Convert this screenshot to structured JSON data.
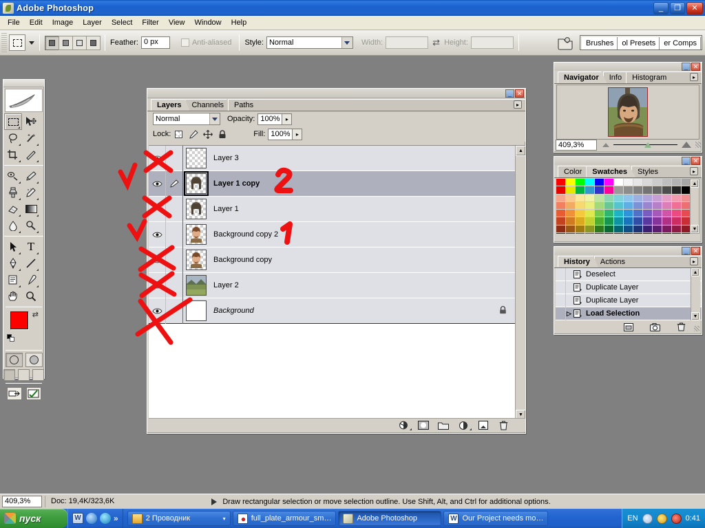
{
  "window": {
    "title": "Adobe Photoshop",
    "minimize_label": "_",
    "maximize_label": "❐",
    "close_label": "✕"
  },
  "menubar": {
    "items": [
      {
        "label": "File"
      },
      {
        "label": "Edit"
      },
      {
        "label": "Image"
      },
      {
        "label": "Layer"
      },
      {
        "label": "Select"
      },
      {
        "label": "Filter"
      },
      {
        "label": "View"
      },
      {
        "label": "Window"
      },
      {
        "label": "Help"
      }
    ]
  },
  "options_bar": {
    "tool_icon": "rectangular-marquee-icon",
    "feather_label": "Feather:",
    "feather_value": "0 px",
    "antialias_label": "Anti-aliased",
    "style_label": "Style:",
    "style_value": "Normal",
    "width_label": "Width:",
    "width_value": "",
    "height_label": "Height:",
    "height_value": "",
    "palette_tabs": [
      {
        "label": "Brushes"
      },
      {
        "label": "ol Presets"
      },
      {
        "label": "er Comps"
      }
    ]
  },
  "toolbox": {
    "tools": [
      {
        "name": "rectangular-marquee-tool",
        "selected": true
      },
      {
        "name": "move-tool",
        "selected": false
      },
      {
        "name": "lasso-tool",
        "selected": false
      },
      {
        "name": "magic-wand-tool",
        "selected": false
      },
      {
        "name": "crop-tool",
        "selected": false
      },
      {
        "name": "slice-tool",
        "selected": false
      },
      {
        "name": "healing-brush-tool",
        "selected": false
      },
      {
        "name": "brush-tool",
        "selected": false
      },
      {
        "name": "clone-stamp-tool",
        "selected": false
      },
      {
        "name": "history-brush-tool",
        "selected": false
      },
      {
        "name": "eraser-tool",
        "selected": false
      },
      {
        "name": "gradient-tool",
        "selected": false
      },
      {
        "name": "blur-tool",
        "selected": false
      },
      {
        "name": "dodge-tool",
        "selected": false
      },
      {
        "name": "path-selection-tool",
        "selected": false
      },
      {
        "name": "type-tool",
        "selected": false
      },
      {
        "name": "pen-tool",
        "selected": false
      },
      {
        "name": "line-tool",
        "selected": false
      },
      {
        "name": "notes-tool",
        "selected": false
      },
      {
        "name": "eyedropper-tool",
        "selected": false
      },
      {
        "name": "hand-tool",
        "selected": false
      },
      {
        "name": "zoom-tool",
        "selected": false
      }
    ],
    "foreground_color": "#ff0000",
    "background_color": "#ffffff"
  },
  "layers_panel": {
    "tabs": [
      {
        "label": "Layers",
        "active": true
      },
      {
        "label": "Channels",
        "active": false
      },
      {
        "label": "Paths",
        "active": false
      }
    ],
    "blend_mode": "Normal",
    "opacity_label": "Opacity:",
    "opacity_value": "100%",
    "lock_label": "Lock:",
    "fill_label": "Fill:",
    "fill_value": "100%",
    "lock_buttons": [
      {
        "name": "lock-transparent-pixels"
      },
      {
        "name": "lock-image-pixels"
      },
      {
        "name": "lock-position"
      },
      {
        "name": "lock-all"
      }
    ],
    "layers": [
      {
        "name": "Layer 3",
        "visible": false,
        "selected": false,
        "thumb": "transparent",
        "locked": false,
        "italic": false
      },
      {
        "name": "Layer 1 copy",
        "visible": true,
        "selected": true,
        "thumb": "helmet",
        "locked": false,
        "italic": false
      },
      {
        "name": "Layer 1",
        "visible": false,
        "selected": false,
        "thumb": "helmet",
        "locked": false,
        "italic": false
      },
      {
        "name": "Background copy 2",
        "visible": true,
        "selected": false,
        "thumb": "face",
        "locked": false,
        "italic": false
      },
      {
        "name": "Background copy",
        "visible": true,
        "selected": false,
        "thumb": "face",
        "locked": false,
        "italic": false
      },
      {
        "name": "Layer 2",
        "visible": true,
        "selected": false,
        "thumb": "landscape",
        "locked": false,
        "italic": false
      },
      {
        "name": "Background",
        "visible": true,
        "selected": false,
        "thumb": "white",
        "locked": true,
        "italic": true
      }
    ],
    "footer_buttons": [
      {
        "name": "layer-style-button"
      },
      {
        "name": "add-layer-mask-button"
      },
      {
        "name": "new-group-button"
      },
      {
        "name": "new-adjustment-layer-button"
      },
      {
        "name": "new-layer-button"
      },
      {
        "name": "delete-layer-button"
      }
    ]
  },
  "navigator_panel": {
    "tabs": [
      {
        "label": "Navigator",
        "active": true
      },
      {
        "label": "Info",
        "active": false
      },
      {
        "label": "Histogram",
        "active": false
      }
    ],
    "zoom_value": "409,3%"
  },
  "color_panel": {
    "tabs": [
      {
        "label": "Color",
        "active": false
      },
      {
        "label": "Swatches",
        "active": true
      },
      {
        "label": "Styles",
        "active": false
      }
    ],
    "swatch_colors": [
      "#ff0000",
      "#ffff00",
      "#00ff00",
      "#00ffff",
      "#0000ff",
      "#ff00ff",
      "#ffffff",
      "#f2f2f2",
      "#e6e6e6",
      "#d9d9d9",
      "#cccccc",
      "#bfbfbf",
      "#b3b3b3",
      "#a6a6a6",
      "#e60000",
      "#e6e600",
      "#00b33c",
      "#3399cc",
      "#3333cc",
      "#ff0099",
      "#999999",
      "#8c8c8c",
      "#808080",
      "#737373",
      "#666666",
      "#4d4d4d",
      "#262626",
      "#000000",
      "#f5a58c",
      "#f7c98f",
      "#fbe79a",
      "#f0f2a8",
      "#bde3a0",
      "#8fd4b0",
      "#7fd0d8",
      "#8fc4ea",
      "#9db0e0",
      "#b0a4d8",
      "#c79fd4",
      "#e39fc6",
      "#f09cae",
      "#ef8f92",
      "#f08060",
      "#f2ab63",
      "#f8d96f",
      "#e9ee7c",
      "#a3d97b",
      "#69c795",
      "#56c3cf",
      "#61aee4",
      "#7b93d6",
      "#9a86cf",
      "#b87fc9",
      "#dc7fb8",
      "#ef6f96",
      "#ec6f73",
      "#e85c33",
      "#ef9237",
      "#f5c93c",
      "#dfe84f",
      "#76c94b",
      "#2fb76f",
      "#1fb2c2",
      "#2f93d9",
      "#4f72c6",
      "#7a5cc0",
      "#a55ab9",
      "#d155a6",
      "#ec4a80",
      "#e84a52",
      "#c44220",
      "#d07a22",
      "#daa91f",
      "#c3d131",
      "#4fae2e",
      "#17964f",
      "#0d93a2",
      "#1a74bb",
      "#2f4fa6",
      "#59389f",
      "#85349a",
      "#b13186",
      "#cc2e63",
      "#c92e36",
      "#8f2d14",
      "#9c5614",
      "#a07a11",
      "#8c9620",
      "#30781c",
      "#0a6a33",
      "#046670",
      "#0d4f86",
      "#1c3377",
      "#3a1f73",
      "#5c1c6f",
      "#7c1a5f",
      "#911a45",
      "#8f1a25",
      "#5e1c08",
      "#6b380a",
      "#6d5208",
      "#5f6614",
      "#1d5210",
      "#04471f",
      "#02444c",
      "#063659",
      "#10214f",
      "#25114c",
      "#3c0f48",
      "#50093d",
      "#5e0a2c",
      "#5e0a16",
      "#d9c9b0",
      "#b79f86",
      "#8f7a60",
      "#6e5a42",
      "#4a3a28",
      "#d9a86b",
      "#c8915a",
      "#b87d48",
      "#a66b38",
      "#92582a",
      "#ffffff",
      "#ffffff",
      "#ffffff",
      "#ffffff"
    ]
  },
  "history_panel": {
    "tabs": [
      {
        "label": "History",
        "active": true
      },
      {
        "label": "Actions",
        "active": false
      }
    ],
    "items": [
      {
        "label": "Deselect",
        "selected": false
      },
      {
        "label": "Duplicate Layer",
        "selected": false
      },
      {
        "label": "Duplicate Layer",
        "selected": false
      },
      {
        "label": "Load Selection",
        "selected": true
      }
    ],
    "footer_buttons": [
      {
        "name": "new-document-from-state-button"
      },
      {
        "name": "create-snapshot-button"
      },
      {
        "name": "delete-state-button"
      }
    ]
  },
  "status_bar": {
    "zoom_value": "409,3%",
    "doc_info": "Doc: 19,4K/323,6K",
    "hint": "Draw rectangular selection or move selection outline.  Use Shift, Alt, and Ctrl for additional options."
  },
  "taskbar": {
    "start_label": "пуск",
    "quicklaunch": [
      {
        "name": "word-quicklaunch-icon"
      },
      {
        "name": "internet-explorer-quicklaunch-icon"
      },
      {
        "name": "outlook-quicklaunch-icon"
      },
      {
        "name": "more-quicklaunch-chevron"
      }
    ],
    "tasks": [
      {
        "label": "2 Проводник",
        "icon": "folder-icon",
        "active": false,
        "has_dropdown": true
      },
      {
        "label": "full_plate_armour_sm…",
        "icon": "image-viewer-icon",
        "active": false,
        "has_dropdown": false
      },
      {
        "label": "Adobe Photoshop",
        "icon": "photoshop-icon",
        "active": true,
        "has_dropdown": false
      },
      {
        "label": "Our Project needs mo…",
        "icon": "word-icon",
        "active": false,
        "has_dropdown": false
      }
    ],
    "tray": {
      "language": "EN",
      "icons": [
        {
          "name": "volume-tray-icon"
        },
        {
          "name": "update-tray-icon"
        },
        {
          "name": "antivirus-tray-icon"
        }
      ],
      "clock": "0:41"
    }
  },
  "annotations": {
    "marks": [
      {
        "type": "check",
        "name": "check-mark-layer-1-copy"
      },
      {
        "type": "check",
        "name": "check-mark-background-copy-2"
      },
      {
        "type": "cross",
        "name": "cross-mark-layer-3"
      },
      {
        "type": "cross",
        "name": "cross-mark-layer-1"
      },
      {
        "type": "cross",
        "name": "cross-mark-background-copy"
      },
      {
        "type": "cross",
        "name": "cross-mark-layer-2"
      },
      {
        "type": "cross",
        "name": "cross-mark-background"
      },
      {
        "type": "digit",
        "name": "annotation-number-2",
        "label": "2"
      },
      {
        "type": "digit",
        "name": "annotation-number-1",
        "label": "1"
      }
    ],
    "color": "#ee1111"
  }
}
